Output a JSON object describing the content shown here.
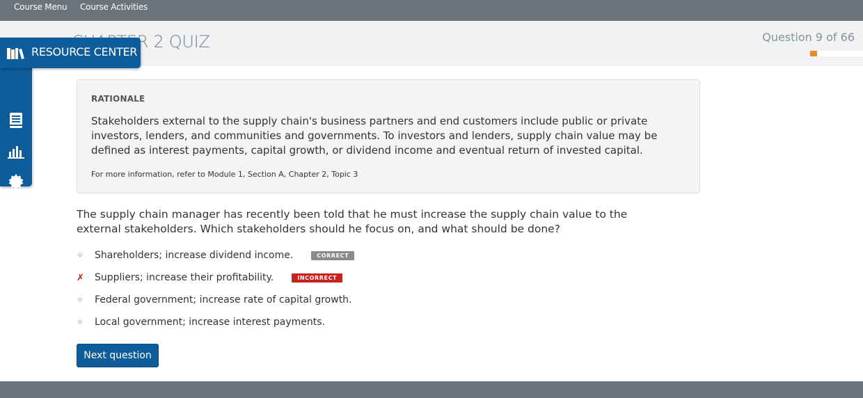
{
  "topnav": {
    "course_menu": "Course Menu",
    "course_activities": "Course Activities"
  },
  "header": {
    "quiz_title": "CHAPTER 2 QUIZ",
    "question_counter": "Question 9 of 66",
    "progress_fraction": 0.136
  },
  "sidebar": {
    "resource_center_label": "RESOURCE CENTER",
    "icons": [
      "books-icon",
      "notebook-icon",
      "bar-chart-icon",
      "gear-icon",
      "help-icon"
    ],
    "help_glyph": "?",
    "accent_color": "#0e5c99"
  },
  "rationale": {
    "title": "RATIONALE",
    "body": "Stakeholders external to the supply chain's business partners and end customers include public or private investors, lenders, and communities and governments. To investors and lenders, supply chain value may be defined as interest payments, capital growth, or dividend income and eventual return of invested capital.",
    "reference": "For more information, refer to Module 1, Section A, Chapter 2, Topic 3"
  },
  "question": {
    "text": "The supply chain manager has recently been told that he must increase the supply chain value to the external stakeholders. Which stakeholders should he focus on, and what should be done?"
  },
  "answers": [
    {
      "text": "Shareholders; increase dividend income.",
      "marker": "✧",
      "badge": "CORRECT"
    },
    {
      "text": "Suppliers; increase their profitability.",
      "marker": "✗",
      "badge": "INCORRECT"
    },
    {
      "text": "Federal government; increase rate of capital growth.",
      "marker": "✧",
      "badge": ""
    },
    {
      "text": "Local government; increase interest payments.",
      "marker": "✧",
      "badge": ""
    }
  ],
  "next_button": {
    "label": "Next question"
  },
  "colors": {
    "progress": "#f0892a",
    "incorrect": "#c9211e",
    "correct_badge": "#8a8a8a"
  }
}
